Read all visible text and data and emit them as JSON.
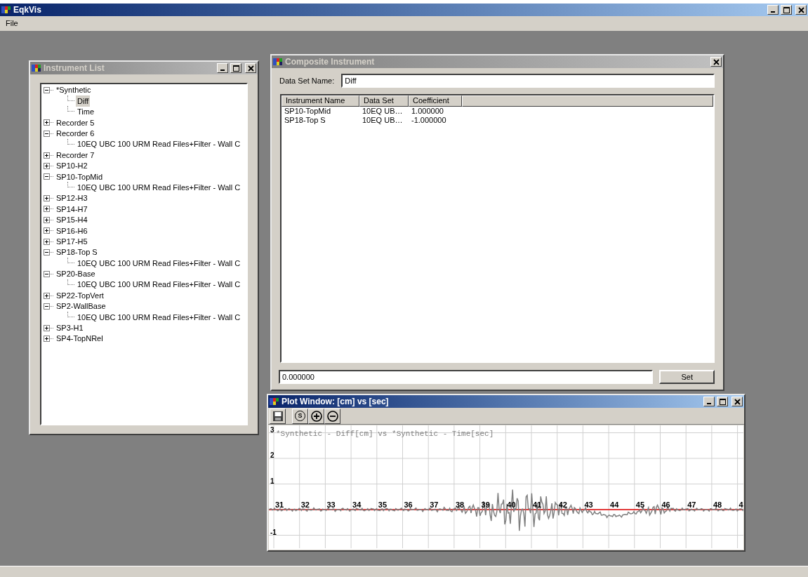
{
  "app": {
    "title": "EqkVis",
    "active": true,
    "controls": [
      {
        "kind": "minimize"
      },
      {
        "kind": "maximize"
      },
      {
        "kind": "close"
      }
    ]
  },
  "menu": [
    "File"
  ],
  "instrument_list": {
    "title": "Instrument List",
    "active": false,
    "controls": [
      {
        "kind": "minimize"
      },
      {
        "kind": "maximize"
      },
      {
        "kind": "close"
      }
    ],
    "tree": [
      {
        "label": "*Synthetic",
        "expanded": true,
        "selected": false,
        "children": [
          {
            "label": "Diff",
            "selected": true
          },
          {
            "label": "Time",
            "selected": false
          }
        ]
      },
      {
        "label": "Recorder 5",
        "expanded": false,
        "selected": false
      },
      {
        "label": "Recorder 6",
        "expanded": true,
        "selected": false,
        "children": [
          {
            "label": "10EQ UBC 100 URM Read Files+Filter - Wall C",
            "selected": false
          }
        ]
      },
      {
        "label": "Recorder 7",
        "expanded": false,
        "selected": false
      },
      {
        "label": "SP10-H2",
        "expanded": false,
        "selected": false
      },
      {
        "label": "SP10-TopMid",
        "expanded": true,
        "selected": false,
        "children": [
          {
            "label": "10EQ UBC 100 URM Read Files+Filter - Wall C",
            "selected": false
          }
        ]
      },
      {
        "label": "SP12-H3",
        "expanded": false,
        "selected": false
      },
      {
        "label": "SP14-H7",
        "expanded": false,
        "selected": false
      },
      {
        "label": "SP15-H4",
        "expanded": false,
        "selected": false
      },
      {
        "label": "SP16-H6",
        "expanded": false,
        "selected": false
      },
      {
        "label": "SP17-H5",
        "expanded": false,
        "selected": false
      },
      {
        "label": "SP18-Top S",
        "expanded": true,
        "selected": false,
        "children": [
          {
            "label": "10EQ UBC 100 URM Read Files+Filter - Wall C",
            "selected": false
          }
        ]
      },
      {
        "label": "SP20-Base",
        "expanded": true,
        "selected": false,
        "children": [
          {
            "label": "10EQ UBC 100 URM Read Files+Filter - Wall C",
            "selected": false
          }
        ]
      },
      {
        "label": "SP22-TopVert",
        "expanded": false,
        "selected": false
      },
      {
        "label": "SP2-WallBase",
        "expanded": true,
        "selected": false,
        "children": [
          {
            "label": "10EQ UBC 100 URM Read Files+Filter - Wall C",
            "selected": false
          }
        ]
      },
      {
        "label": "SP3-H1",
        "expanded": false,
        "selected": false
      },
      {
        "label": "SP4-TopNRel",
        "expanded": false,
        "selected": false
      }
    ]
  },
  "composite": {
    "title": "Composite Instrument",
    "active": false,
    "controls": [
      {
        "kind": "close"
      }
    ],
    "name_label": "Data Set Name:",
    "name_value": "Diff",
    "columns": [
      "Instrument Name",
      "Data Set",
      "Coefficient"
    ],
    "rows": [
      [
        "SP10-TopMid",
        "10EQ UB…",
        "1.000000"
      ],
      [
        "SP18-Top S",
        "10EQ UB…",
        "-1.000000"
      ]
    ],
    "coefficient_value": "0.000000",
    "set_button": "Set"
  },
  "plot": {
    "title": "Plot Window: [cm] vs [sec]",
    "active": true,
    "controls": [
      {
        "kind": "minimize"
      },
      {
        "kind": "maximize"
      },
      {
        "kind": "close"
      }
    ],
    "toolbar": [
      {
        "kind": "save"
      },
      {
        "kind": "letter",
        "label": "S"
      },
      {
        "kind": "zoom_in"
      },
      {
        "kind": "zoom_out"
      }
    ],
    "caption": "*Synthetic - Diff[cm] vs *Synthetic - Time[sec]",
    "y_ticks": [
      "3",
      "2",
      "1",
      "-1"
    ],
    "x_ticks": [
      "31",
      "32",
      "33",
      "34",
      "35",
      "36",
      "37",
      "38",
      "39",
      "40",
      "41",
      "42",
      "43",
      "44",
      "45",
      "46",
      "47",
      "48",
      "4"
    ]
  }
}
